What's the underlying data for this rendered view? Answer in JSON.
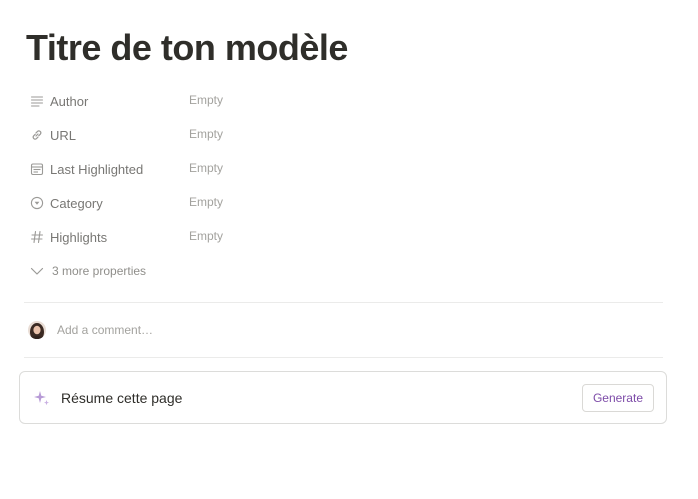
{
  "page": {
    "title": "Titre de ton modèle"
  },
  "properties": [
    {
      "label": "Author",
      "value": "Empty",
      "icon": "text-lines-icon"
    },
    {
      "label": "URL",
      "value": "Empty",
      "icon": "link-icon"
    },
    {
      "label": "Last Highlighted",
      "value": "Empty",
      "icon": "calendar-icon"
    },
    {
      "label": "Category",
      "value": "Empty",
      "icon": "select-circle-icon"
    },
    {
      "label": "Highlights",
      "value": "Empty",
      "icon": "hash-icon"
    }
  ],
  "more_properties": {
    "label": "3 more properties",
    "icon": "chevron-down-icon"
  },
  "comment": {
    "placeholder": "Add a comment…"
  },
  "ai_block": {
    "prompt": "Résume cette page",
    "button_label": "Generate",
    "icon": "sparkle-icon",
    "accent_color": "#7d4ba8"
  }
}
